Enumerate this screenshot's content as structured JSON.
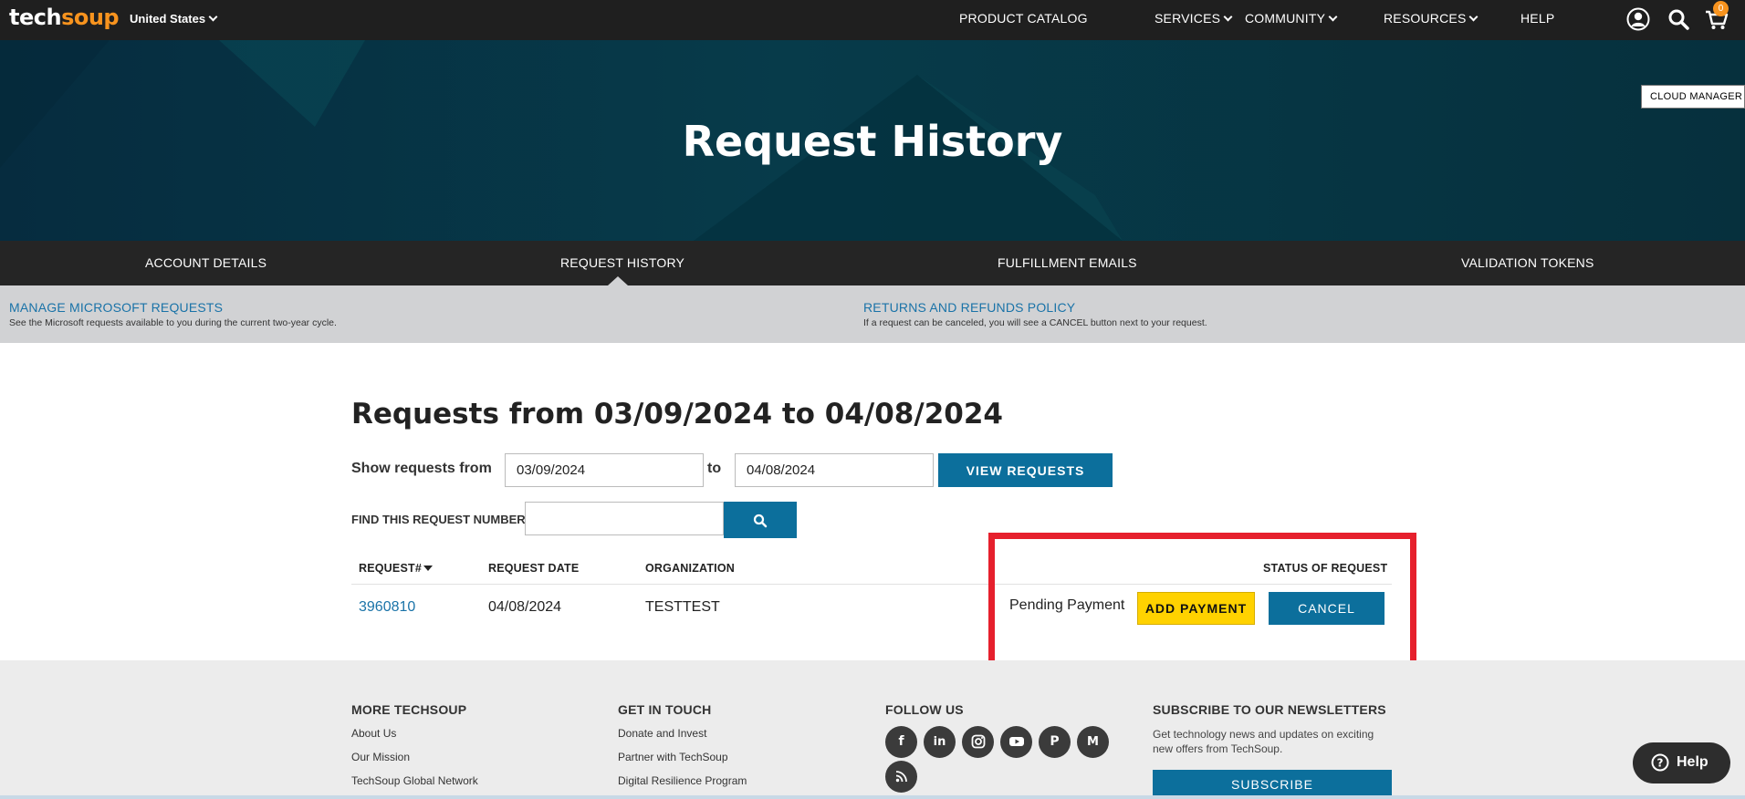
{
  "brand": {
    "logo_part1": "tech",
    "logo_part2": "soup",
    "region": "United States"
  },
  "topnav": {
    "items": [
      "PRODUCT CATALOG",
      "SERVICES",
      "COMMUNITY",
      "RESOURCES",
      "HELP"
    ],
    "cart_count": "0",
    "icons": [
      "user-icon",
      "search-icon",
      "cart-icon"
    ]
  },
  "hero": {
    "title": "Request History",
    "cloud_manager": "CLOUD MANAGER"
  },
  "tabs": [
    "ACCOUNT DETAILS",
    "REQUEST HISTORY",
    "FULFILLMENT EMAILS",
    "VALIDATION TOKENS"
  ],
  "active_tab": "REQUEST HISTORY",
  "links": [
    {
      "title": "MANAGE MICROSOFT REQUESTS",
      "desc": "See the Microsoft requests available to you during the current two-year cycle."
    },
    {
      "title": "RETURNS AND REFUNDS POLICY",
      "desc": "If a request can be canceled, you will see a CANCEL button next to your request."
    }
  ],
  "main": {
    "heading": "Requests from 03/09/2024 to 04/08/2024",
    "show_label": "Show requests from",
    "from_value": "03/09/2024",
    "to_label": "to",
    "to_value": "04/08/2024",
    "view_button": "VIEW REQUESTS",
    "find_label": "FIND THIS REQUEST NUMBER",
    "find_value": ""
  },
  "table": {
    "headers": [
      "REQUEST#",
      "REQUEST DATE",
      "ORGANIZATION",
      "STATUS OF REQUEST"
    ],
    "rows": [
      {
        "request": "3960810",
        "date": "04/08/2024",
        "org": "TESTTEST",
        "status": "Pending Payment",
        "add_payment": "ADD PAYMENT",
        "cancel": "CANCEL"
      }
    ]
  },
  "footer": {
    "col1": {
      "title": "MORE TECHSOUP",
      "links": [
        "About Us",
        "Our Mission",
        "TechSoup Global Network"
      ]
    },
    "col2": {
      "title": "GET IN TOUCH",
      "links": [
        "Donate and Invest",
        "Partner with TechSoup",
        "Digital Resilience Program"
      ]
    },
    "col3": {
      "title": "FOLLOW US",
      "icons": [
        "facebook-icon",
        "linkedin-icon",
        "instagram-icon",
        "youtube-icon",
        "pinterest-icon",
        "medium-icon",
        "rss-icon"
      ]
    },
    "col4": {
      "title": "SUBSCRIBE TO OUR NEWSLETTERS",
      "desc": "Get technology news and updates on exciting new offers from TechSoup.",
      "button": "SUBSCRIBE"
    }
  },
  "help_widget": {
    "label": "Help"
  },
  "colors": {
    "accent_blue": "#0c6f9c",
    "orange": "#f7931e",
    "yellow": "#ffd200",
    "highlight_red": "#e6202d"
  }
}
